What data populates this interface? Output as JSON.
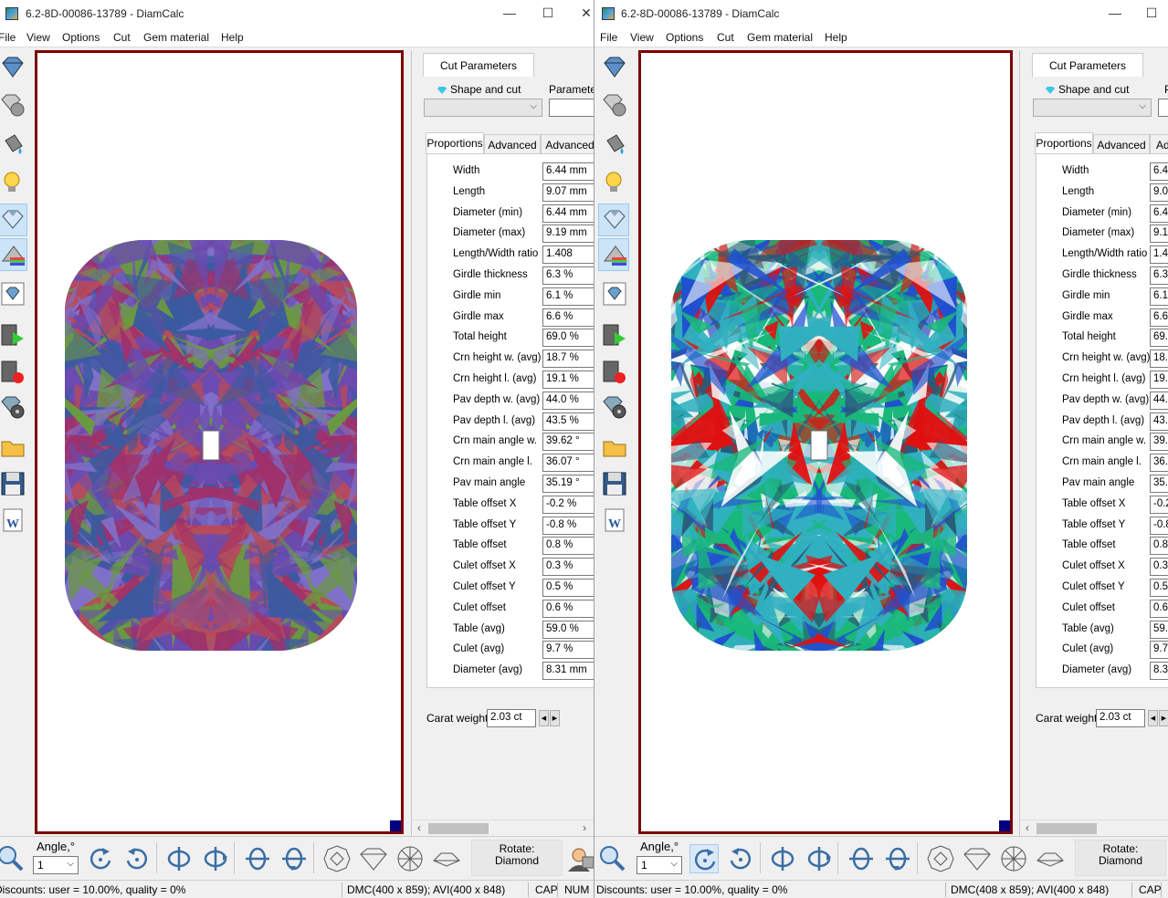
{
  "windows": [
    {
      "title": "6.2-8D-00086-13789 - DiamCalc",
      "menu": [
        "File",
        "View",
        "Options",
        "Cut",
        "Gem material",
        "Help"
      ],
      "panel": {
        "tab_title": "Cut Parameters",
        "shape_label": "Shape and cut",
        "parameter_label": "Parameter",
        "subtabs": [
          "Proportions",
          "Advanced",
          "Advanced"
        ],
        "carat_label": "Carat weight",
        "carat_value": "2.03 ct"
      },
      "bottom": {
        "angle_label": "Angle,°",
        "angle_value": "1",
        "rotate_label": "Rotate:",
        "rotate_value": "Diamond"
      },
      "status": {
        "discounts": "Discounts: user = 10.00%, quality = 0%",
        "dmc": "DMC(400 x 859); AVI(400 x 848)",
        "cap": "CAP",
        "num": "NUM"
      }
    },
    {
      "title": "6.2-8D-00086-13789 - DiamCalc",
      "menu": [
        "File",
        "View",
        "Options",
        "Cut",
        "Gem material",
        "Help"
      ],
      "panel": {
        "tab_title": "Cut Parameters",
        "shape_label": "Shape and cut",
        "parameter_label": "Pa",
        "subtabs": [
          "Proportions",
          "Advanced",
          "Adv"
        ],
        "carat_label": "Carat weight",
        "carat_value": "2.03 ct"
      },
      "bottom": {
        "angle_label": "Angle,°",
        "angle_value": "1",
        "rotate_label": "Rotate:",
        "rotate_value": "Diamond"
      },
      "status": {
        "discounts": "Discounts: user = 10.00%, quality = 0%",
        "dmc": "DMC(408 x 859); AVI(400 x 848)",
        "cap": "CAP",
        "num": ""
      }
    }
  ],
  "params": [
    {
      "label": "Width",
      "left": "6.44 mm",
      "right": "6.4"
    },
    {
      "label": "Length",
      "left": "9.07 mm",
      "right": "9.0"
    },
    {
      "label": "Diameter (min)",
      "left": "6.44 mm",
      "right": "6.4"
    },
    {
      "label": "Diameter (max)",
      "left": "9.19 mm",
      "right": "9.1"
    },
    {
      "label": "Length/Width ratio",
      "left": "1.408",
      "right": "1.4"
    },
    {
      "label": "Girdle thickness",
      "left": "6.3 %",
      "right": "6.3"
    },
    {
      "label": "Girdle min",
      "left": "6.1 %",
      "right": "6.1"
    },
    {
      "label": "Girdle max",
      "left": "6.6 %",
      "right": "6.6"
    },
    {
      "label": "Total height",
      "left": "69.0 %",
      "right": "69."
    },
    {
      "label": "Crn height w. (avg)",
      "left": "18.7 %",
      "right": "18."
    },
    {
      "label": "Crn height l. (avg)",
      "left": "19.1 %",
      "right": "19."
    },
    {
      "label": "Pav depth w. (avg)",
      "left": "44.0 %",
      "right": "44."
    },
    {
      "label": "Pav depth l. (avg)",
      "left": "43.5 %",
      "right": "43."
    },
    {
      "label": "Crn main angle w.",
      "left": "39.62 °",
      "right": "39."
    },
    {
      "label": "Crn main angle l.",
      "left": "36.07 °",
      "right": "36."
    },
    {
      "label": "Pav main angle",
      "left": "35.19 °",
      "right": "35."
    },
    {
      "label": "Table offset X",
      "left": "-0.2 %",
      "right": "-0.2"
    },
    {
      "label": "Table offset Y",
      "left": "-0.8 %",
      "right": "-0.8"
    },
    {
      "label": "Table offset",
      "left": "0.8 %",
      "right": "0.8"
    },
    {
      "label": "Culet offset X",
      "left": "0.3 %",
      "right": "0.3"
    },
    {
      "label": "Culet offset Y",
      "left": "0.5 %",
      "right": "0.5"
    },
    {
      "label": "Culet offset",
      "left": "0.6 %",
      "right": "0.6"
    },
    {
      "label": "Table (avg)",
      "left": "59.0 %",
      "right": "59."
    },
    {
      "label": "Culet (avg)",
      "left": "9.7 %",
      "right": "9.7"
    },
    {
      "label": "Diameter (avg)",
      "left": "8.31 mm",
      "right": "8.3"
    }
  ],
  "colors": {
    "viewport_border": "#7a0000",
    "left_gem": [
      "#6a4bb0",
      "#a0306a",
      "#6a9a40",
      "#3a5aa0",
      "#b84a5a",
      "#8070c8"
    ],
    "right_gem": [
      "#19b87a",
      "#2a5a78",
      "#e01010",
      "#2050d0",
      "#30b0c0",
      "#ffffff"
    ]
  }
}
